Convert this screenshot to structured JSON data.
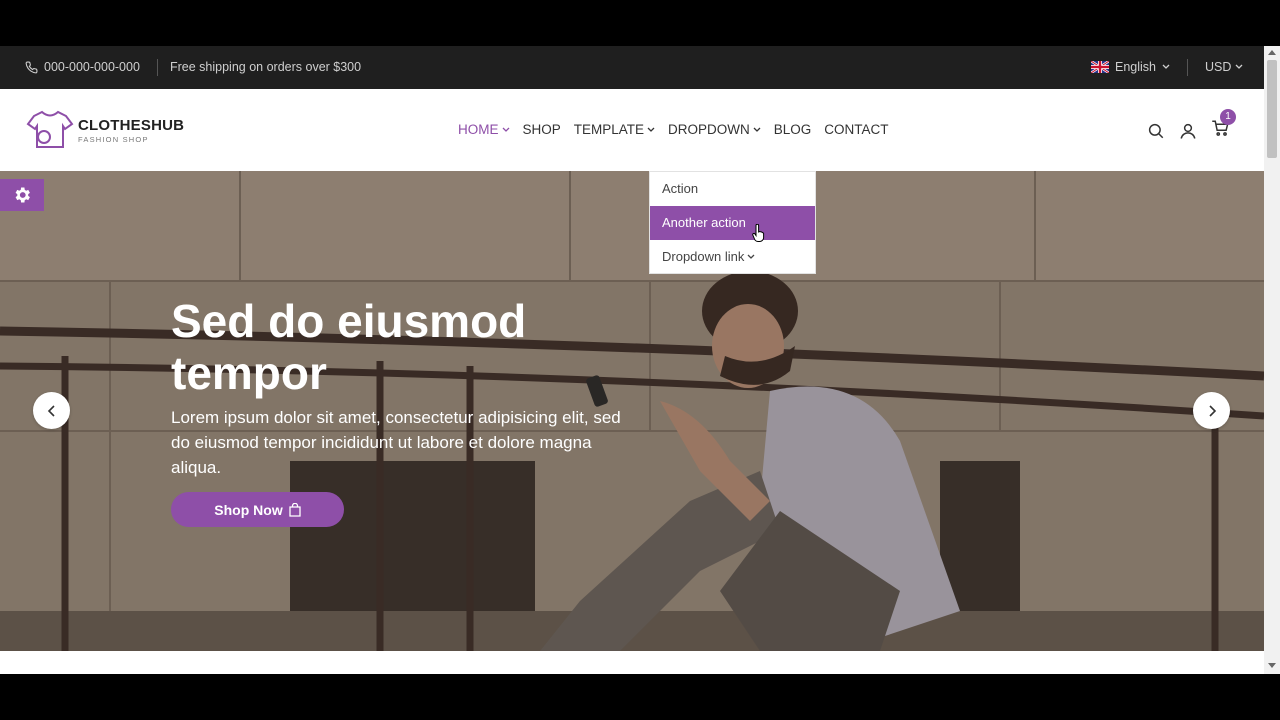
{
  "topbar": {
    "phone": "000-000-000-000",
    "shipping": "Free shipping on orders over $300",
    "language": "English",
    "currency": "USD"
  },
  "brand": {
    "name": "CLOTHESHUB",
    "tagline": "FASHION SHOP"
  },
  "nav": {
    "home": "HOME",
    "shop": "SHOP",
    "template": "TEMPLATE",
    "dropdown": "DROPDOWN",
    "blog": "BLOG",
    "contact": "CONTACT"
  },
  "cart": {
    "count": "1"
  },
  "dropdown_menu": {
    "item1": "Action",
    "item2": "Another action",
    "item3": "Dropdown link"
  },
  "hero": {
    "title": "Sed do eiusmod tempor",
    "text": "Lorem ipsum dolor sit amet, consectetur adipisicing elit, sed do eiusmod tempor incididunt ut labore et dolore magna aliqua.",
    "button": "Shop Now"
  },
  "colors": {
    "accent": "#8e4fa8",
    "topbar": "#1f1f1f"
  }
}
